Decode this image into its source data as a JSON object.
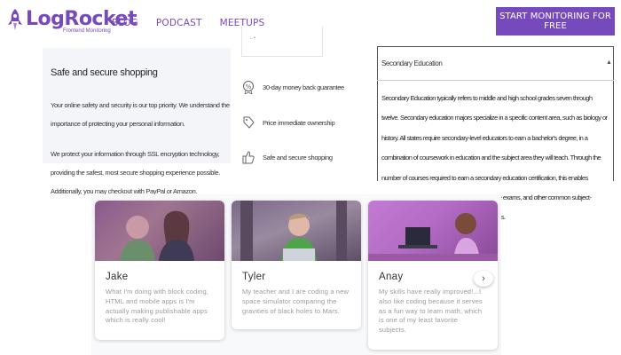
{
  "header": {
    "logo_name": "LogRocket",
    "logo_sub": "Frontend Monitoring",
    "nav": [
      "BLOG",
      "PODCAST",
      "MEETUPS"
    ],
    "cta": "START MONITORING FOR FREE",
    "brand_color": "#764abc"
  },
  "safe": {
    "title": "Safe and secure shopping",
    "p1": "Your online safety and security is our top priority. We understand the importance of protecting your personal information.",
    "p2": "We protect your information through SSL encryption technology, providing the safest, most secure shopping experience possible. Additionally, you may checkout with PayPal or Amazon."
  },
  "features": [
    {
      "icon": "percent-badge-icon",
      "label": "30-day money back guarantee"
    },
    {
      "icon": "tag-icon",
      "label": "Price immediate ownership"
    },
    {
      "icon": "thumbs-up-icon",
      "label": "Safe and secure shopping"
    }
  ],
  "education": {
    "title": "Secondary Education",
    "body": "Secondary Education typically refers to middle and high school grades seven through twelve. Secondary education majors specialize in a specific content area, such as biology or history. All states require secondary-level educators to earn a bachelor's degree, in a combination of coursework in education and the subject area they will teach. Through the number of courses required to earn a secondary education certification, this enables program entrance exams, pedagogy knowledge exams, and other common subject-specific exams to ensure that qualified candidates."
  },
  "testimonials": [
    {
      "name": "Jake",
      "quote": "What I'm doing with block coding, HTML and mobile apps is I'm actually making publishable apps which is really cool!"
    },
    {
      "name": "Tyler",
      "quote": "My teacher and I are coding a new space simulator comparing the gravities of black holes to Mars."
    },
    {
      "name": "Anay",
      "quote": "My skills have really improved!...I also like coding because it serves as a fun way to learn math, which is one of my least favorite subjects."
    }
  ]
}
